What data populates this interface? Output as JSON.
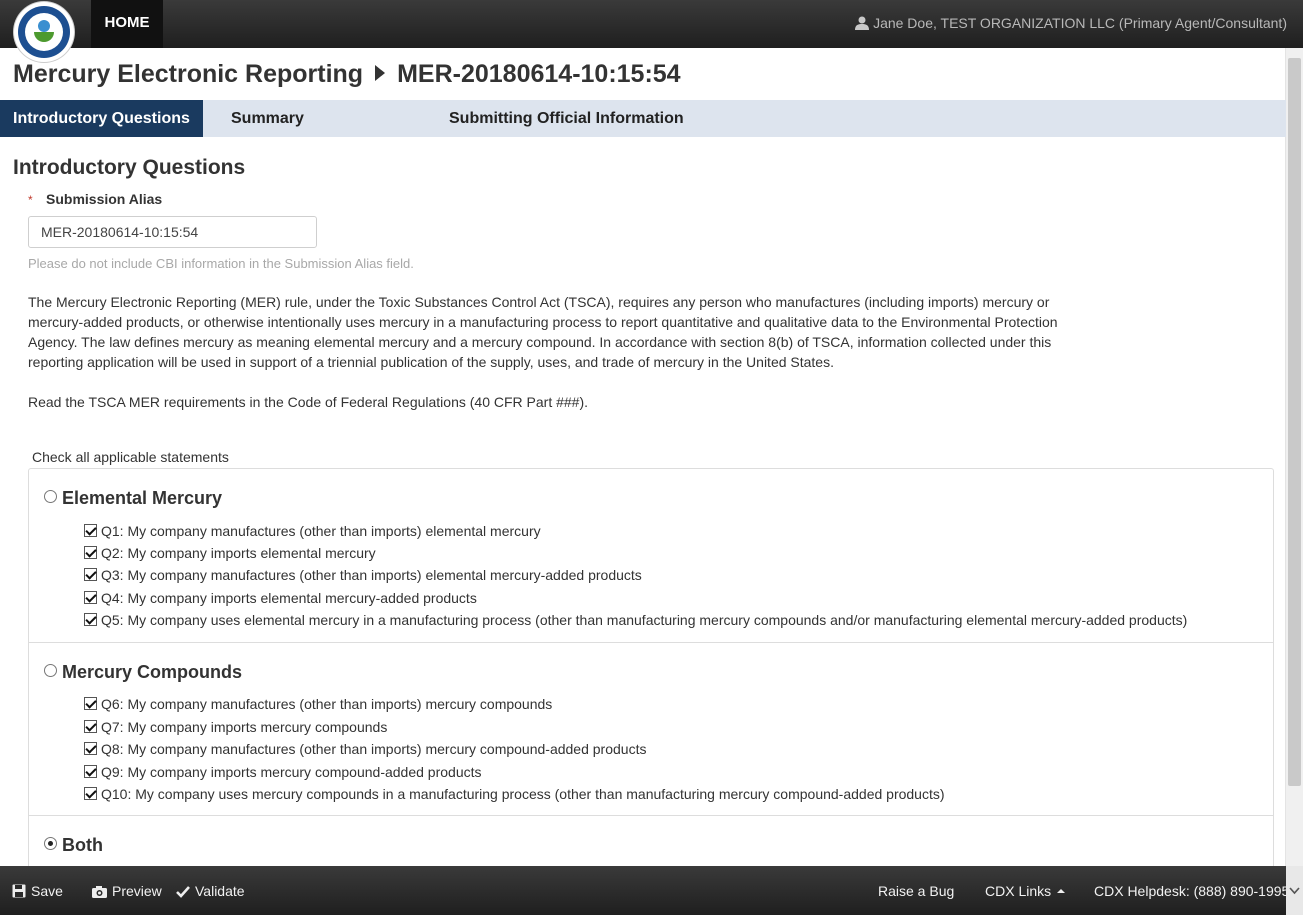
{
  "nav": {
    "home_label": "HOME",
    "user_text": "Jane Doe, TEST ORGANIZATION LLC (Primary Agent/Consultant)"
  },
  "page": {
    "app_title": "Mercury Electronic Reporting",
    "submission_id": "MER-20180614-10:15:54"
  },
  "tabs": [
    {
      "label": "Introductory Questions",
      "active": true
    },
    {
      "label": "Summary",
      "active": false
    },
    {
      "label": "Submitting Official Information",
      "active": false
    }
  ],
  "section": {
    "heading": "Introductory Questions",
    "required_marker": "*",
    "alias_label": "Submission Alias",
    "alias_value": "MER-20180614-10:15:54",
    "alias_hint": "Please do not include CBI information in the Submission Alias field.",
    "intro_paragraph": "The Mercury Electronic Reporting (MER) rule, under the Toxic Substances Control Act (TSCA), requires any person who manufactures (including imports) mercury or mercury-added products, or otherwise intentionally uses mercury in a manufacturing process to report quantitative and qualitative data to the Environmental Protection Agency. The law defines mercury as meaning elemental mercury and a mercury compound. In accordance with section 8(b) of TSCA, information collected under this reporting application will be used in support of a triennial publication of the supply, uses, and trade of mercury in the United States.",
    "cfr_text": "Read the TSCA MER requirements in the Code of Federal Regulations (40 CFR Part ###).",
    "check_all_label": "Check all applicable statements"
  },
  "groups": [
    {
      "label": "Elemental Mercury",
      "selected": false,
      "questions": [
        {
          "text": "Q1: My company manufactures (other than imports) elemental mercury",
          "checked": true
        },
        {
          "text": "Q2: My company imports elemental mercury",
          "checked": true
        },
        {
          "text": "Q3: My company manufactures (other than imports) elemental mercury-added products",
          "checked": true
        },
        {
          "text": "Q4: My company imports elemental mercury-added products",
          "checked": true
        },
        {
          "text": "Q5: My company uses elemental mercury in a manufacturing process (other than manufacturing mercury compounds and/or manufacturing elemental mercury-added products)",
          "checked": true
        }
      ]
    },
    {
      "label": "Mercury Compounds",
      "selected": false,
      "questions": [
        {
          "text": "Q6: My company manufactures (other than imports) mercury compounds",
          "checked": true
        },
        {
          "text": "Q7: My company imports mercury compounds",
          "checked": true
        },
        {
          "text": "Q8: My company manufactures (other than imports) mercury compound-added products",
          "checked": true
        },
        {
          "text": "Q9: My company imports mercury compound-added products",
          "checked": true
        },
        {
          "text": "Q10: My company uses mercury compounds in a manufacturing process (other than manufacturing mercury compound-added products)",
          "checked": true
        }
      ]
    },
    {
      "label": "Both",
      "selected": true,
      "questions": []
    }
  ],
  "footer": {
    "save_label": "Save",
    "preview_label": "Preview",
    "validate_label": "Validate",
    "bug_label": "Raise a Bug",
    "cdx_links_label": "CDX Links",
    "helpdesk_label": "CDX Helpdesk: (888) 890-1995"
  },
  "colors": {
    "active_tab": "#1a3a5f",
    "tab_bar": "#dde4ee",
    "top_bar": "#2b2b2b"
  }
}
